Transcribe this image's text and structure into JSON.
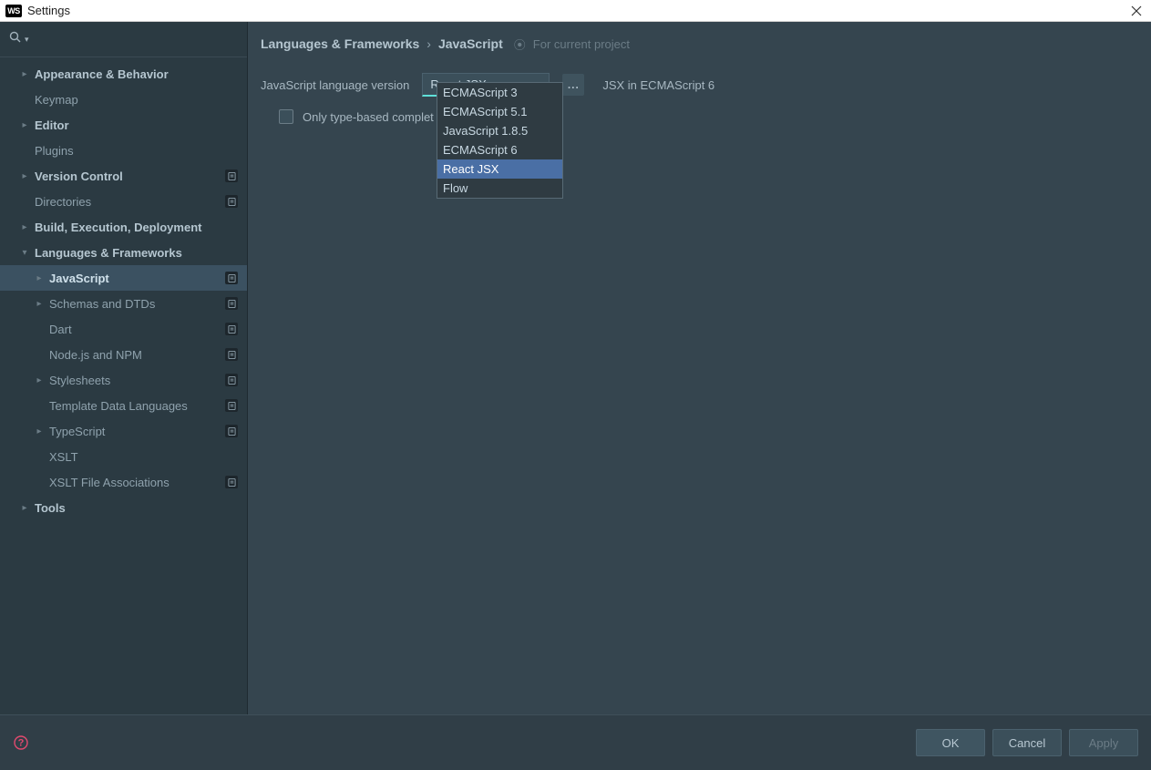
{
  "titlebar": {
    "badge": "WS",
    "title": "Settings"
  },
  "sidebar": {
    "search_icon": "search",
    "items": [
      {
        "label": "Appearance & Behavior",
        "level": 0,
        "caret": true,
        "bold": true
      },
      {
        "label": "Keymap",
        "level": 0
      },
      {
        "label": "Editor",
        "level": 0,
        "caret": true,
        "bold": true
      },
      {
        "label": "Plugins",
        "level": 0
      },
      {
        "label": "Version Control",
        "level": 0,
        "caret": true,
        "bold": true,
        "badge": true
      },
      {
        "label": "Directories",
        "level": 0,
        "badge": true
      },
      {
        "label": "Build, Execution, Deployment",
        "level": 0,
        "caret": true,
        "bold": true
      },
      {
        "label": "Languages & Frameworks",
        "level": 0,
        "caret": true,
        "expanded": true,
        "bold": true
      },
      {
        "label": "JavaScript",
        "level": 1,
        "caret": true,
        "selected": true,
        "badge": true
      },
      {
        "label": "Schemas and DTDs",
        "level": 1,
        "caret": true,
        "badge": true
      },
      {
        "label": "Dart",
        "level": 1,
        "badge": true
      },
      {
        "label": "Node.js and NPM",
        "level": 1,
        "badge": true
      },
      {
        "label": "Stylesheets",
        "level": 1,
        "caret": true,
        "badge": true
      },
      {
        "label": "Template Data Languages",
        "level": 1,
        "badge": true
      },
      {
        "label": "TypeScript",
        "level": 1,
        "caret": true,
        "badge": true
      },
      {
        "label": "XSLT",
        "level": 1
      },
      {
        "label": "XSLT File Associations",
        "level": 1,
        "badge": true
      },
      {
        "label": "Tools",
        "level": 0,
        "caret": true,
        "bold": true
      }
    ]
  },
  "breadcrumb": {
    "parent": "Languages & Frameworks",
    "sep": "›",
    "current": "JavaScript",
    "scope": "For current project"
  },
  "form": {
    "version_label": "JavaScript language version",
    "version_value": "React JSX",
    "hint": "JSX in ECMAScript 6",
    "more": "...",
    "checkbox_label": "Only type-based complet",
    "options": [
      "ECMAScript 3",
      "ECMAScript 5.1",
      "JavaScript 1.8.5",
      "ECMAScript 6",
      "React JSX",
      "Flow"
    ],
    "selected_option": "React JSX"
  },
  "footer": {
    "ok": "OK",
    "cancel": "Cancel",
    "apply": "Apply"
  }
}
